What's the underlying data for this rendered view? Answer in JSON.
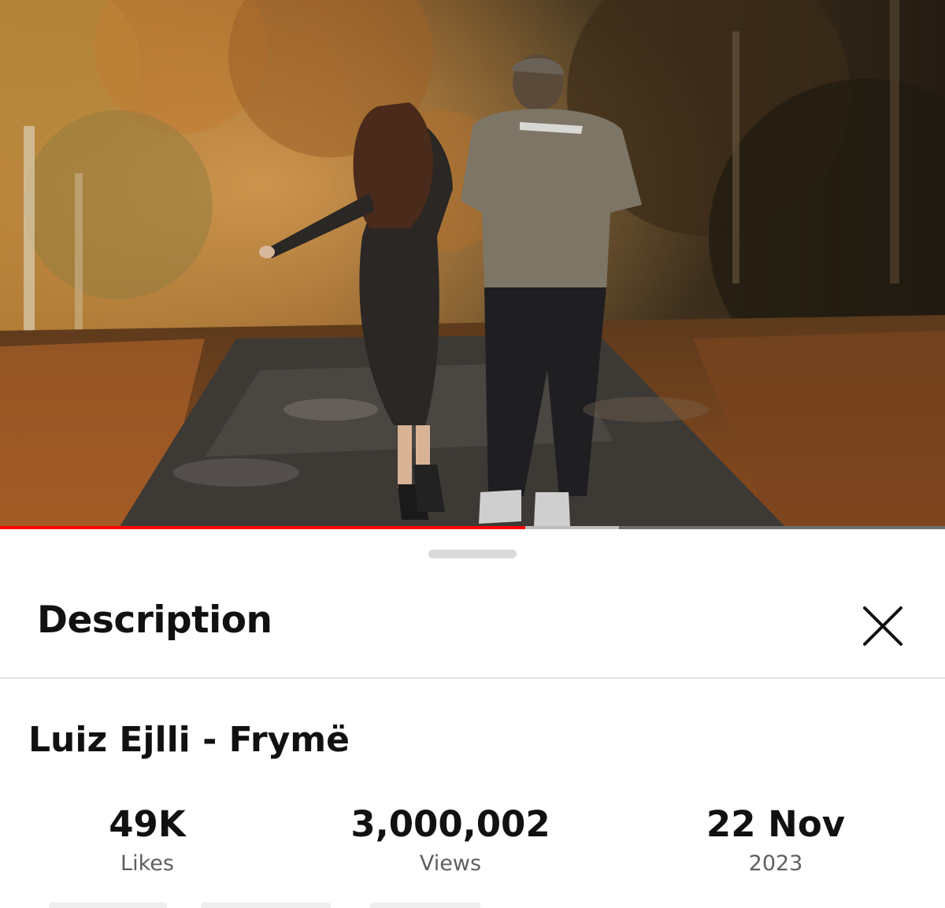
{
  "sheet": {
    "title": "Description",
    "close_icon": "close-icon"
  },
  "video": {
    "title": "Luiz Ejlli - Frymë",
    "progress_played": 0.556,
    "progress_buffered": 0.655,
    "thumbnail": "couple walking on autumn forest road"
  },
  "stats": {
    "likes": {
      "value": "49K",
      "label": "Likes"
    },
    "views": {
      "value": "3,000,002",
      "label": "Views"
    },
    "date": {
      "value": "22 Nov",
      "label": "2023"
    }
  },
  "colors": {
    "accent": "#ff0000",
    "text": "#111111",
    "muted": "#5f5f5f"
  }
}
